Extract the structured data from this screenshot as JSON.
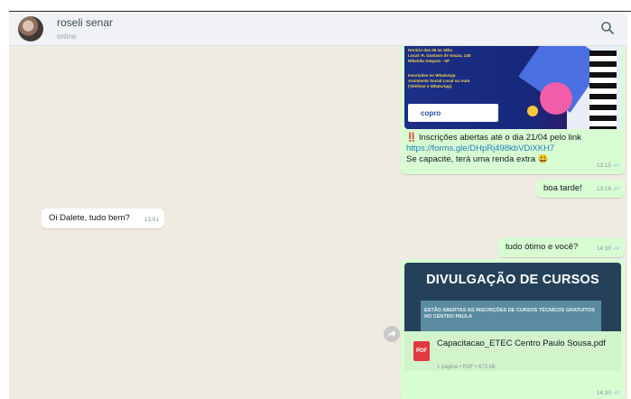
{
  "contact": {
    "name": "roseli senar",
    "status": "online"
  },
  "header": {
    "search_icon": "search-icon"
  },
  "messages": {
    "m1": {
      "image_lines": [
        "Horário das 08 às 18hs",
        "Local: R. Gustavo de Souza, 148",
        "Ribeirão Amparo - SP",
        "Inscrições no WhatsApp",
        "Assistente Social Local ou Auto",
        "(Telefone e WhatsApp)"
      ],
      "image_logo": "copro",
      "alert": "‼️",
      "line1": "Inscrições abertas até o dia 21/04 pelo link",
      "link": "https://forms.gle/DHpRj498kbVDiXKH7",
      "line3": "Se capacite, terá uma renda extra 😃",
      "time": "13:15"
    },
    "m2": {
      "text": "boa tarde!",
      "time": "13:16"
    },
    "m3": {
      "text": "Oi Dalete, tudo bem?",
      "time": "13:51"
    },
    "m4": {
      "text": "tudo ótimo e você?",
      "time": "14:30"
    },
    "m5": {
      "banner_title": "DIVULGAÇÃO DE CURSOS",
      "banner_sub": "ESTÃO ABERTAS AS INSCRIÇÕES DE CURSOS TÉCNICOS GRATUITOS NO CENTRO PAULA",
      "pdf_label": "PDF",
      "file_name": "Capacitacao_ETEC Centro Paulo Sousa.pdf",
      "file_meta": "1 página • PDF • 673 kB",
      "time": "14:30"
    }
  }
}
